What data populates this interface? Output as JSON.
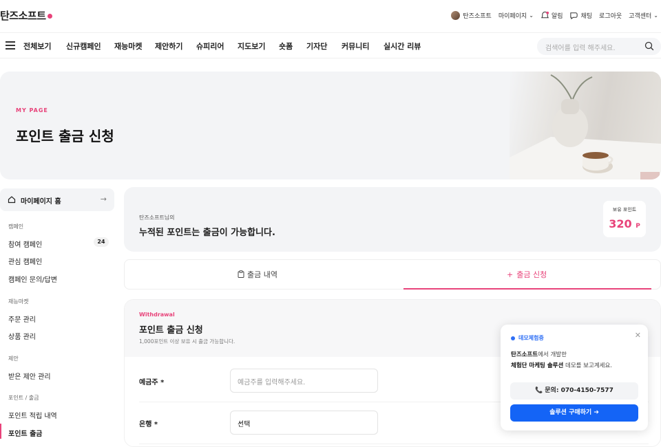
{
  "brand": {
    "name": "탄즈소프트",
    "accent": "#e8437a"
  },
  "topbar": {
    "user": "탄즈소프트",
    "mypage": "마이페이지",
    "alarm": "알림",
    "chat": "채팅",
    "logout": "로그아웃",
    "support": "고객센터"
  },
  "nav": {
    "all": "전체보기",
    "items": [
      "신규캠페인",
      "재능마켓",
      "제안하기",
      "슈피리어",
      "지도보기",
      "숏폼",
      "기자단",
      "커뮤니티",
      "실시간 리뷰"
    ],
    "search_placeholder": "검색어를 입력 해주세요."
  },
  "hero": {
    "kicker": "MY PAGE",
    "title": "포인트 출금 신청"
  },
  "sidebar": {
    "home": "마이페이지 홈",
    "sections": [
      {
        "title": "캠페인",
        "items": [
          "참여 캠페인",
          "관심 캠페인",
          "캠페인 문의/답변"
        ],
        "badge": "24"
      },
      {
        "title": "재능마켓",
        "items": [
          "주문 관리",
          "상품 관리"
        ]
      },
      {
        "title": "제안",
        "items": [
          "받은 제안 관리"
        ]
      },
      {
        "title": "포인트 / 출금",
        "items": [
          "포인트 적립 내역",
          "포인트 출금"
        ]
      }
    ]
  },
  "summary": {
    "subtitle": "탄즈소프트님의",
    "title": "누적된 포인트는 출금이 가능합니다.",
    "points_label": "보유 포인트",
    "points_value": "320",
    "points_unit": "P"
  },
  "tabs": {
    "history": "출금 내역",
    "request": "출금 신청"
  },
  "form": {
    "kicker": "Withdrawal",
    "title": "포인트 출금 신청",
    "desc": "1,000포인트 이상 보유 시 출금 가능합니다.",
    "holder_label": "예금주 *",
    "holder_placeholder": "예금주를 입력해주세요.",
    "bank_label": "은행 *",
    "bank_value": "선택"
  },
  "popup": {
    "tag": "데모체험중",
    "line1_bold": "탄즈소프트",
    "line1_rest": "에서 개발한",
    "line2_bold": "체험단 마케팅 솔루션",
    "line2_rest": " 데모를 보고계세요.",
    "call": "문의: 070-4150-7577",
    "buy": "솔루션 구매하기 ➔"
  }
}
